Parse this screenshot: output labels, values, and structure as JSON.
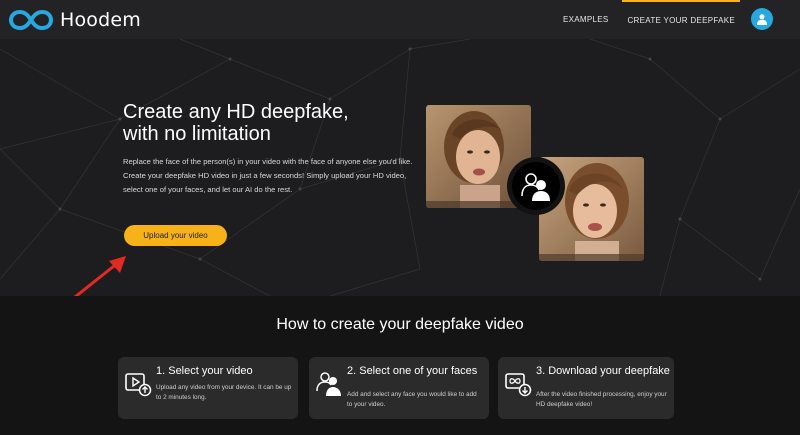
{
  "header": {
    "brand": "Hoodem",
    "nav": [
      {
        "label": "EXAMPLES"
      },
      {
        "label": "CREATE YOUR DEEPFAKE"
      }
    ]
  },
  "hero": {
    "title_line1": "Create any HD deepfake,",
    "title_line2": "with no limitation",
    "description": "Replace the face of the person(s) in your video with the face of anyone else you'd like. Create your deepfake HD video in just a few seconds! Simply upload your HD video, select one of your faces, and let our AI do the rest.",
    "upload_label": "Upload your video"
  },
  "how": {
    "title": "How to create your deepfake video",
    "steps": [
      {
        "title": "1. Select your video",
        "desc": "Upload any video from your device. It can be up to 2 minutes long.",
        "icon": "video-upload-icon"
      },
      {
        "title": "2. Select one of your faces",
        "desc": "Add and select any face you would like to add to your video.",
        "icon": "face-swap-icon"
      },
      {
        "title": "3. Download your deepfake",
        "desc": "After the video finished processing, enjoy your HD deepfake video!",
        "icon": "download-icon"
      }
    ]
  },
  "colors": {
    "accent": "#f6b218",
    "brand_blue": "#27a9e0",
    "hero_bg": "#1d1d1f",
    "section_bg": "#141414",
    "card_bg": "#2b2b2b"
  }
}
